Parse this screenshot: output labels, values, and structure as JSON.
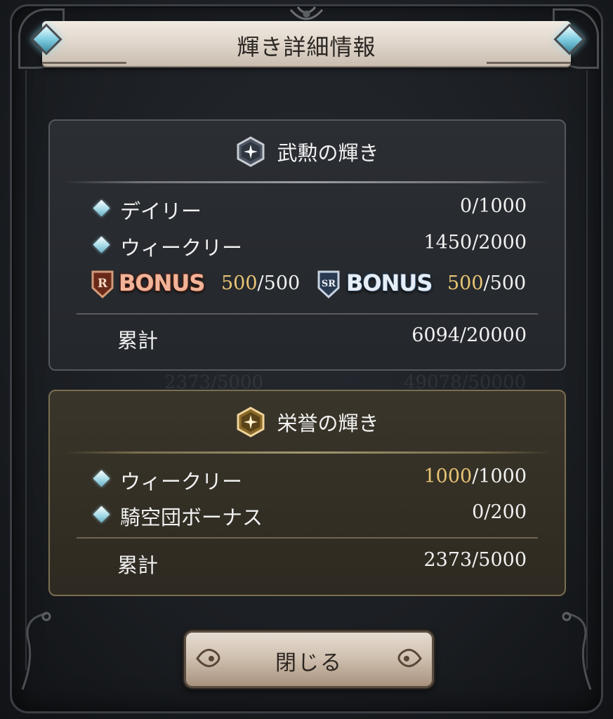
{
  "dialog": {
    "title": "輝き詳細情報",
    "close_label": "閉じる"
  },
  "buin": {
    "title": "武勲の輝き",
    "rows": [
      {
        "label": "デイリー",
        "current": "0",
        "max": "/1000"
      },
      {
        "label": "ウィークリー",
        "current": "1450",
        "max": "/2000"
      }
    ],
    "bonus_r": {
      "word": "BONUS",
      "badge": "R",
      "current": "500",
      "max": "/500"
    },
    "bonus_sr": {
      "word": "BONUS",
      "badge": "SR",
      "current": "500",
      "max": "/500"
    },
    "total": {
      "label": "累計",
      "value": "6094/20000"
    }
  },
  "eiyo": {
    "title": "栄誉の輝き",
    "rows": [
      {
        "label": "ウィークリー",
        "current": "1000",
        "max": "/1000"
      },
      {
        "label": "騎空団ボーナス",
        "current": "0",
        "max": "/200"
      }
    ],
    "total": {
      "label": "累計",
      "value": "2373/5000"
    }
  },
  "colors": {
    "gold_highlight": "#e8c474",
    "buin_panel": "#2b2e33",
    "eiyo_panel": "#3a352a"
  },
  "icons": [
    "diamond-bullet-icon",
    "silver-crest-icon",
    "gold-crest-icon",
    "r-badge-icon",
    "sr-badge-icon",
    "corner-gem-icon"
  ]
}
